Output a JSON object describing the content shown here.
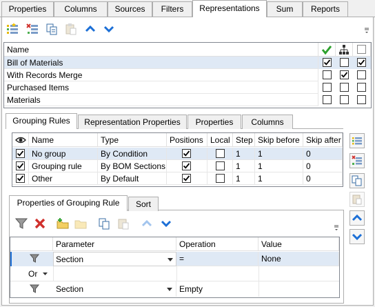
{
  "top_tabs": [
    "Properties",
    "Columns",
    "Sources",
    "Filters",
    "Representations",
    "Sum",
    "Reports"
  ],
  "representations": {
    "header_name": "Name",
    "rows": [
      {
        "name": "Bill of Materials",
        "c1": true,
        "c2": false,
        "c3": true
      },
      {
        "name": "With Records Merge",
        "c1": false,
        "c2": true,
        "c3": false
      },
      {
        "name": "Purchased Items",
        "c1": false,
        "c2": false,
        "c3": false
      },
      {
        "name": "Materials",
        "c1": false,
        "c2": false,
        "c3": false
      }
    ]
  },
  "sub_tabs": [
    "Grouping Rules",
    "Representation Properties",
    "Properties",
    "Columns"
  ],
  "grouping": {
    "headers": [
      "Name",
      "Type",
      "Positions",
      "Local",
      "Step",
      "Skip before",
      "Skip after"
    ],
    "rows": [
      {
        "visible": true,
        "name": "No group",
        "type": "By Condition",
        "positions": true,
        "local": false,
        "step": "1",
        "skip_before": "1",
        "skip_after": "0"
      },
      {
        "visible": true,
        "name": "Grouping rule",
        "type": "By BOM Sections",
        "positions": true,
        "local": false,
        "step": "1",
        "skip_before": "1",
        "skip_after": "0"
      },
      {
        "visible": true,
        "name": "Other",
        "type": "By Default",
        "positions": true,
        "local": false,
        "step": "1",
        "skip_before": "1",
        "skip_after": "0"
      }
    ]
  },
  "lower_tabs": [
    "Properties of Grouping Rule",
    "Sort"
  ],
  "conditions": {
    "headers": [
      "Parameter",
      "Operation",
      "Value"
    ],
    "rows": [
      {
        "logic": "",
        "parameter": "Section",
        "operation": "=",
        "value": "None"
      },
      {
        "logic": "Or",
        "parameter": "",
        "operation": "",
        "value": ""
      },
      {
        "logic": "",
        "parameter": "Section",
        "operation": "Empty",
        "value": ""
      }
    ]
  },
  "colors": {
    "accent_blue": "#1c6fd6",
    "select_bg": "#dfe9f5",
    "green_check": "#2ea12e",
    "red_x": "#d0312d"
  }
}
